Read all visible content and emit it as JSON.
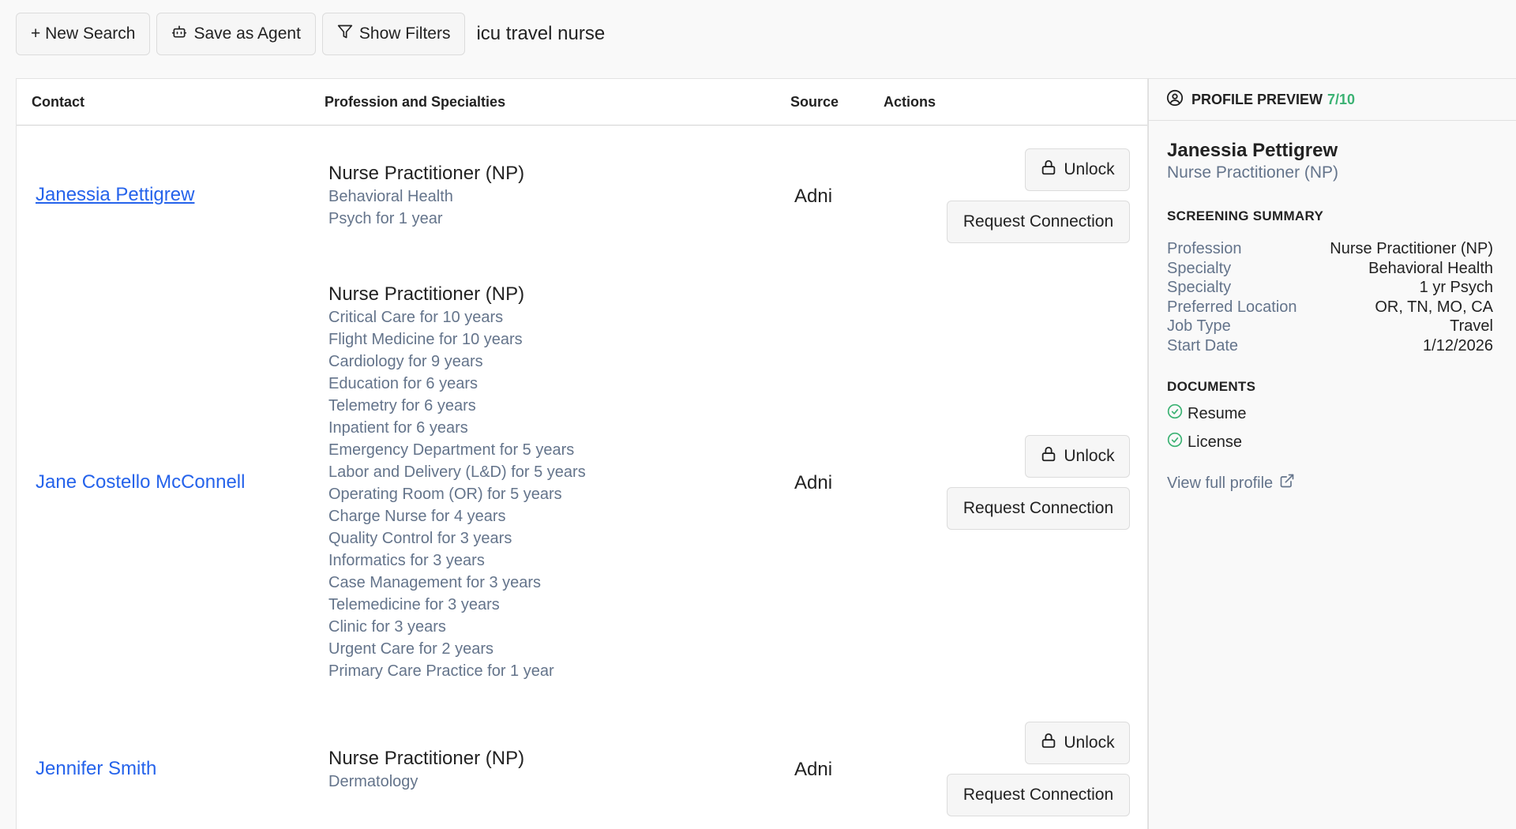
{
  "toolbar": {
    "new_search": "+ New Search",
    "save_agent": "Save as Agent",
    "show_filters": "Show Filters",
    "query": "icu travel nurse"
  },
  "table": {
    "headers": {
      "contact": "Contact",
      "profession": "Profession and Specialties",
      "source": "Source",
      "actions": "Actions"
    },
    "rows": [
      {
        "name": "Janessia Pettigrew",
        "profession": "Nurse Practitioner (NP)",
        "specialties": [
          "Behavioral Health",
          "Psych for 1 year"
        ],
        "source": "Adni",
        "unlock": "Unlock",
        "request": "Request Connection"
      },
      {
        "name": "Jane Costello McConnell",
        "profession": "Nurse Practitioner (NP)",
        "specialties": [
          "Critical Care for 10 years",
          "Flight Medicine for 10 years",
          "Cardiology for 9 years",
          "Education for 6 years",
          "Telemetry for 6 years",
          "Inpatient for 6 years",
          "Emergency Department for 5 years",
          "Labor and Delivery (L&D) for 5 years",
          "Operating Room (OR) for 5 years",
          "Charge Nurse for 4 years",
          "Quality Control for 3 years",
          "Informatics for 3 years",
          "Case Management for 3 years",
          "Telemedicine for 3 years",
          "Clinic for 3 years",
          "Urgent Care for 2 years",
          "Primary Care Practice for 1 year"
        ],
        "source": "Adni",
        "unlock": "Unlock",
        "request": "Request Connection"
      },
      {
        "name": "Jennifer Smith",
        "profession": "Nurse Practitioner (NP)",
        "specialties": [
          "Dermatology"
        ],
        "source": "Adni",
        "unlock": "Unlock",
        "request": "Request Connection"
      }
    ]
  },
  "preview": {
    "title": "PROFILE PREVIEW",
    "score": "7/10",
    "name": "Janessia Pettigrew",
    "subtitle": "Nurse Practitioner (NP)",
    "screening_title": "SCREENING SUMMARY",
    "screening": [
      {
        "k": "Profession",
        "v": "Nurse Practitioner (NP)"
      },
      {
        "k": "Specialty",
        "v": "Behavioral Health"
      },
      {
        "k": "Specialty",
        "v": "1 yr Psych"
      },
      {
        "k": "Preferred Location",
        "v": "OR, TN, MO, CA"
      },
      {
        "k": "Job Type",
        "v": "Travel"
      },
      {
        "k": "Start Date",
        "v": "1/12/2026"
      }
    ],
    "documents_title": "DOCUMENTS",
    "documents": [
      "Resume",
      "License"
    ],
    "view_full": "View full profile"
  },
  "colors": {
    "link": "#2563eb",
    "muted": "#64748b",
    "success": "#3bb273"
  }
}
